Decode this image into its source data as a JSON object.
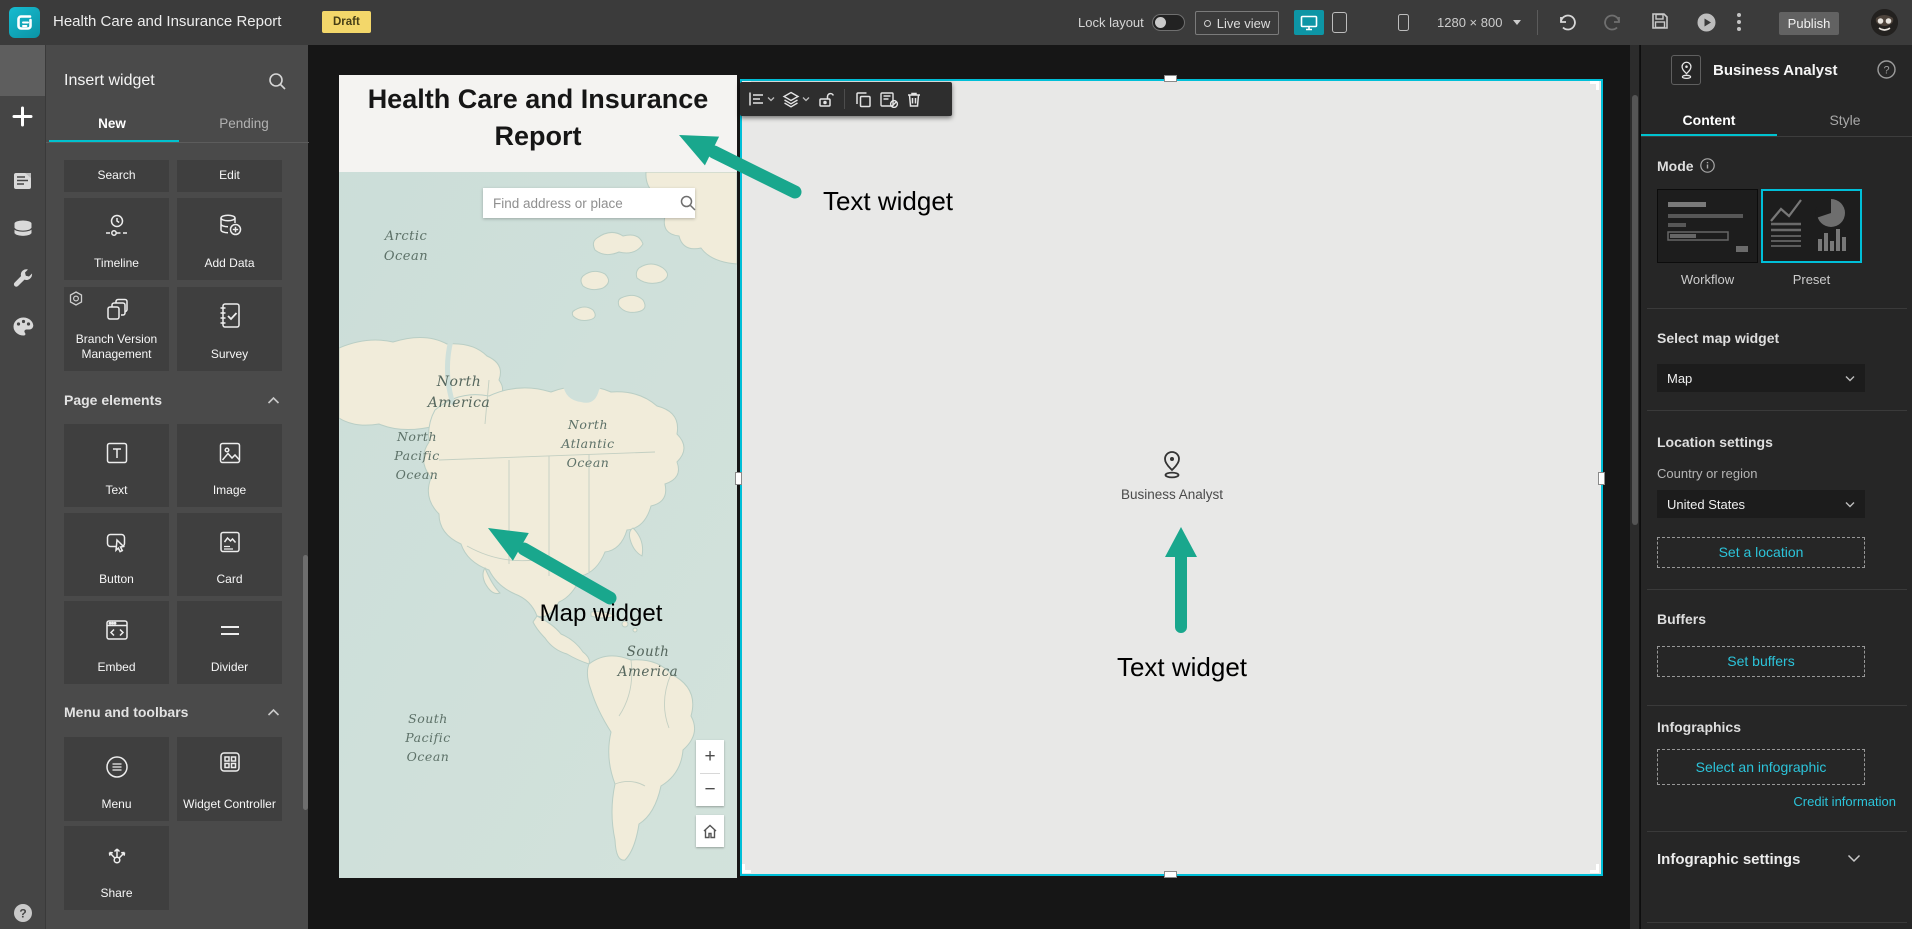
{
  "topbar": {
    "app_title": "Health Care and Insurance Report",
    "status_badge": "Draft",
    "lock_layout_label": "Lock layout",
    "live_view_label": "Live view",
    "resolution": "1280 × 800",
    "publish_label": "Publish"
  },
  "insert_panel": {
    "title": "Insert widget",
    "tabs": {
      "new": "New",
      "pending": "Pending"
    },
    "partial_tiles": [
      {
        "label": "Search"
      },
      {
        "label": "Edit"
      }
    ],
    "default_tiles": [
      {
        "label": "Timeline"
      },
      {
        "label": "Add Data"
      },
      {
        "label": "Branch Version Management"
      },
      {
        "label": "Survey"
      }
    ],
    "sections": [
      {
        "title": "Page elements",
        "tiles": [
          {
            "label": "Text"
          },
          {
            "label": "Image"
          },
          {
            "label": "Button"
          },
          {
            "label": "Card"
          },
          {
            "label": "Embed"
          },
          {
            "label": "Divider"
          }
        ]
      },
      {
        "title": "Menu and toolbars",
        "tiles": [
          {
            "label": "Menu"
          },
          {
            "label": "Widget Controller"
          },
          {
            "label": "Share"
          }
        ]
      }
    ]
  },
  "canvas": {
    "page_title": "Health Care and Insurance Report",
    "map": {
      "search_placeholder": "Find address or place",
      "zoom_in": "+",
      "zoom_out": "−",
      "labels": {
        "arctic": "Arctic Ocean",
        "north_america": "North America",
        "north_pacific": "North Pacific Ocean",
        "north_atlantic": "North Atlantic Ocean",
        "south_america": "South America",
        "south_pacific": "South Pacific Ocean"
      }
    },
    "ba_placeholder": "Business Analyst",
    "annotations": {
      "text_widget_title": "Text widget",
      "map_widget": "Map widget",
      "text_widget_ba": "Text widget"
    }
  },
  "right_panel": {
    "title": "Business Analyst",
    "tabs": {
      "content": "Content",
      "style": "Style"
    },
    "mode": {
      "label": "Mode",
      "options": [
        "Workflow",
        "Preset"
      ],
      "selected": "Preset"
    },
    "select_map_widget_label": "Select map widget",
    "map_widget_value": "Map",
    "location_settings_label": "Location settings",
    "country_label": "Country or region",
    "country_value": "United States",
    "set_location_label": "Set a location",
    "buffers_label": "Buffers",
    "set_buffers_label": "Set buffers",
    "infographics_label": "Infographics",
    "select_infographic_label": "Select an infographic",
    "credit_information_label": "Credit information",
    "infographic_settings_label": "Infographic settings"
  },
  "colors": {
    "selection_accent": "#00bfd8",
    "tab_accent": "#00c2cf",
    "annotation_arrow": "#19a78d",
    "draft_badge": "#f3d76a"
  }
}
